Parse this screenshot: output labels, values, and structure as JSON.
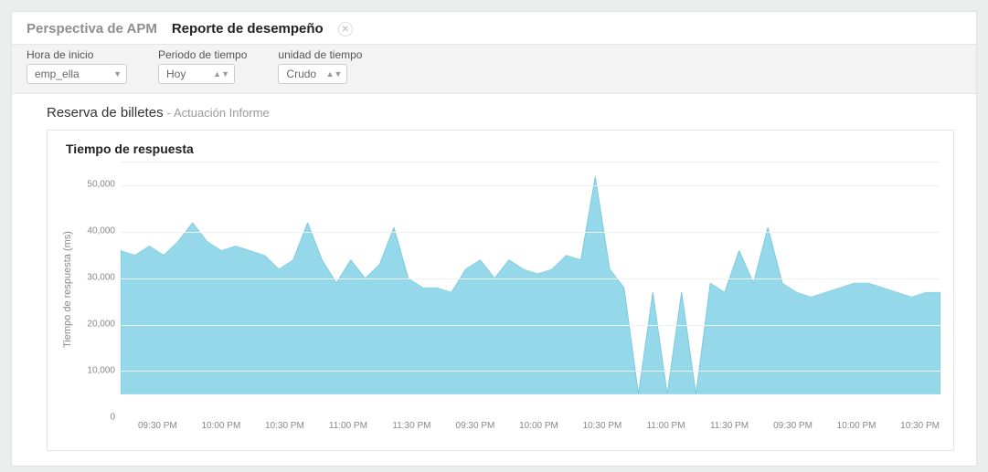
{
  "breadcrumb": {
    "parent": "Perspectiva de APM",
    "current": "Reporte de desempeño"
  },
  "filters": {
    "start_label": "Hora de inicio",
    "start_value": "emp_ella",
    "period_label": "Periodo de tiempo",
    "period_value": "Hoy",
    "unit_label": "unidad de tiempo",
    "unit_value": "Crudo"
  },
  "report": {
    "name": "Reserva de billetes",
    "subtitle": "- Actuación Informe"
  },
  "chart_title": "Tiempo de respuesta",
  "ylabel": "Tiempo de respuesta (ms)",
  "chart_data": {
    "type": "area",
    "title": "Tiempo de respuesta",
    "ylabel": "Tiempo de respuesta (ms)",
    "ylim": [
      0,
      55000
    ],
    "yticks": [
      0,
      10000,
      20000,
      30000,
      40000,
      50000
    ],
    "ytick_labels": [
      "0",
      "10,000",
      "20,000",
      "30,000",
      "40,000",
      "50,000"
    ],
    "x_tick_labels": [
      "09:30 PM",
      "10:00 PM",
      "10:30 PM",
      "11:00 PM",
      "11:30 PM",
      "09:30 PM",
      "10:00 PM",
      "10:30 PM",
      "11:00 PM",
      "11:30 PM",
      "09:30 PM",
      "10:00 PM",
      "10:30 PM"
    ],
    "values": [
      36000,
      35000,
      37000,
      35000,
      38000,
      42000,
      38000,
      36000,
      37000,
      36000,
      35000,
      32000,
      34000,
      42000,
      34000,
      29000,
      34000,
      30000,
      33000,
      41000,
      30000,
      28000,
      28000,
      27000,
      32000,
      34000,
      30000,
      34000,
      32000,
      31000,
      32000,
      35000,
      34000,
      52000,
      32000,
      28000,
      5000,
      27000,
      5000,
      27000,
      5000,
      29000,
      27000,
      36000,
      29000,
      41000,
      29000,
      27000,
      26000,
      27000,
      28000,
      29000,
      29000,
      28000,
      27000,
      26000,
      27000,
      27000
    ],
    "floor": 5000
  }
}
